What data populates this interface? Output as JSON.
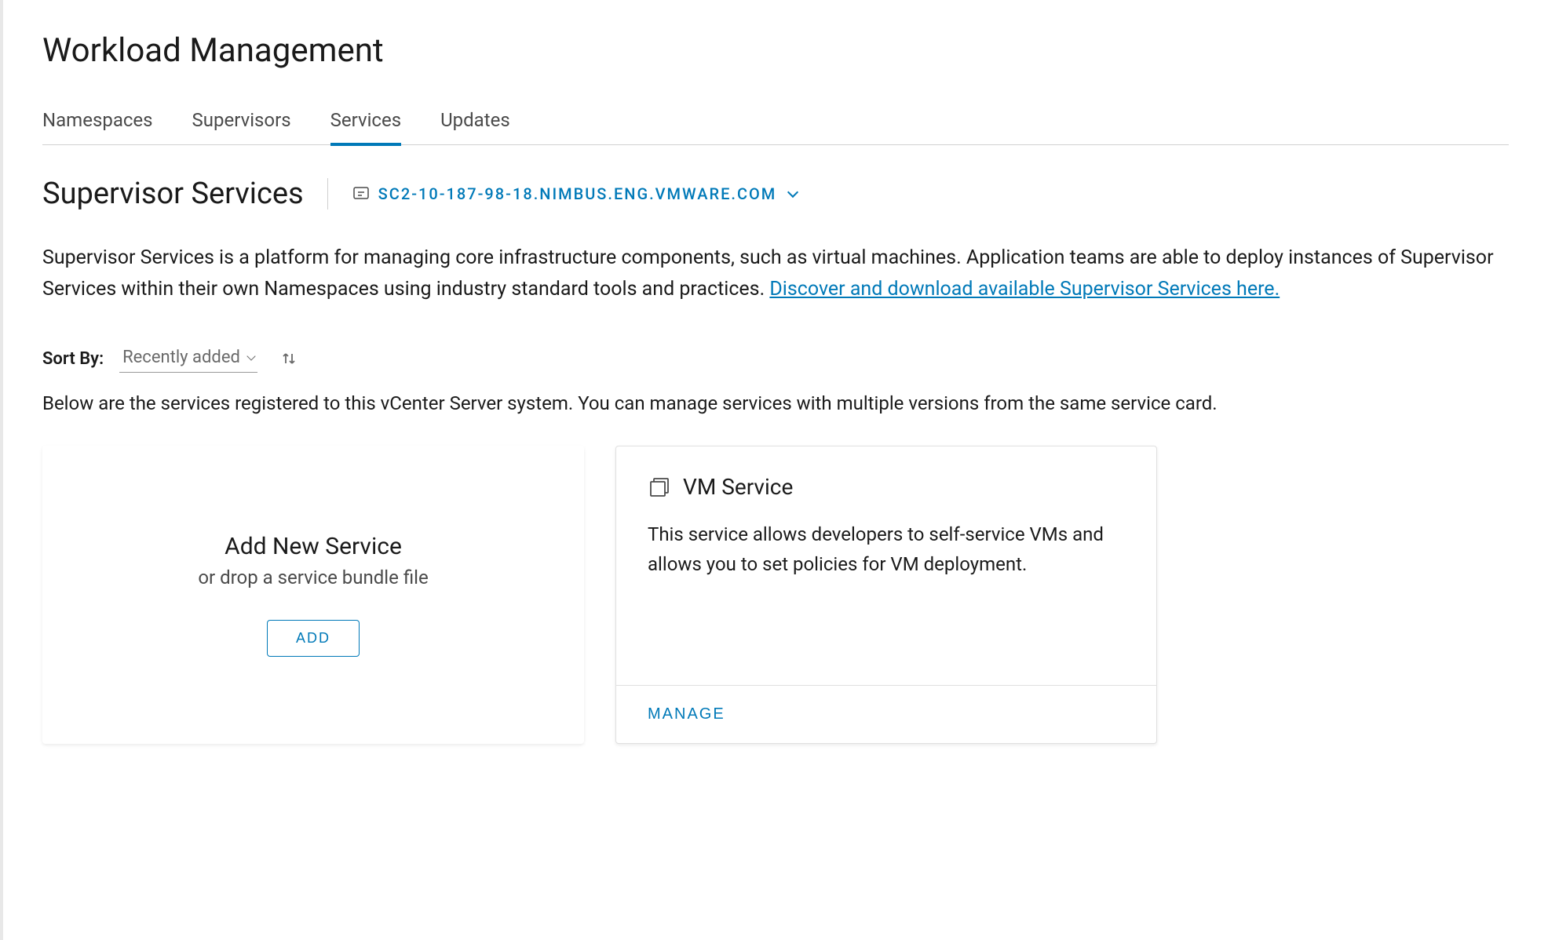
{
  "page": {
    "title": "Workload Management"
  },
  "tabs": [
    {
      "label": "Namespaces",
      "active": false
    },
    {
      "label": "Supervisors",
      "active": false
    },
    {
      "label": "Services",
      "active": true
    },
    {
      "label": "Updates",
      "active": false
    }
  ],
  "section": {
    "title": "Supervisor Services",
    "server": "SC2-10-187-98-18.NIMBUS.ENG.VMWARE.COM"
  },
  "description": {
    "text": "Supervisor Services is a platform for managing core infrastructure components, such as virtual machines. Application teams are able to deploy instances of Supervisor Services within their own Namespaces using industry standard tools and practices. ",
    "link_text": "Discover and download available Supervisor Services here."
  },
  "sort": {
    "label": "Sort By:",
    "selected": "Recently added"
  },
  "sub_description": "Below are the services registered to this vCenter Server system. You can manage services with multiple versions from the same service card.",
  "add_card": {
    "title": "Add New Service",
    "subtitle": "or drop a service bundle file",
    "button": "ADD"
  },
  "service_card": {
    "title": "VM Service",
    "description": "This service allows developers to self-service VMs and allows you to set policies for VM deployment.",
    "manage_button": "MANAGE"
  }
}
